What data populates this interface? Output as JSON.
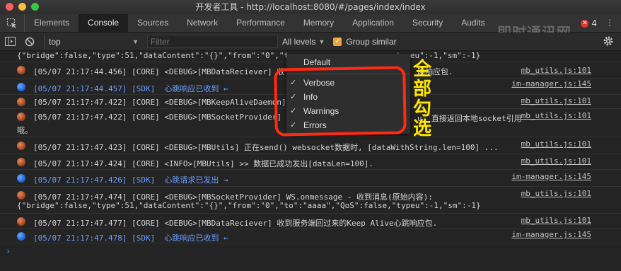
{
  "window": {
    "title": "开发者工具 - http://localhost:8080/#/pages/index/index"
  },
  "tabs": [
    "Elements",
    "Console",
    "Sources",
    "Network",
    "Performance",
    "Memory",
    "Application",
    "Security",
    "Audits"
  ],
  "active_tab": "Console",
  "error_count": "4",
  "toolbar": {
    "context": "top",
    "filter_placeholder": "Filter",
    "levels_label": "All levels",
    "group_similar_label": "Group similar"
  },
  "levels_menu": {
    "items": [
      {
        "label": "Default",
        "checked": false
      },
      {
        "label": "Verbose",
        "checked": true
      },
      {
        "label": "Info",
        "checked": true
      },
      {
        "label": "Warnings",
        "checked": true
      },
      {
        "label": "Errors",
        "checked": true
      }
    ]
  },
  "annotation": {
    "line1": "全",
    "line2": "部",
    "line3": "勾",
    "line4": "选"
  },
  "watermark": "即时通讯网",
  "console": {
    "rows": [
      {
        "kind": "cont",
        "text": "{\"bridge\":false,\"type\":51,\"dataContent\":\"{}\",\"from\":\"0\",\"t",
        "tail": "typeu\":-1,\"sm\":-1}",
        "source": ""
      },
      {
        "kind": "core",
        "text": "[05/07 21:17:44.456] [CORE] <DEBUG>[MBDataReciever] 收",
        "tail": "跳响应包.",
        "source": "mb_utils.js:101"
      },
      {
        "kind": "sdk",
        "text": "[05/07 21:17:44.457] [SDK]  心跳响应已收到 ←",
        "tail": "",
        "source": "im-manager.js:145"
      },
      {
        "kind": "core",
        "text": "[05/07 21:17:47.422] [CORE] <DEBUG>[MBKeepAliveDaemon]",
        "tail": "",
        "source": "mb_utils.js:101"
      },
      {
        "kind": "core",
        "text": "[05/07 21:17:47.422] [CORE] <DEBUG>[MBSocketProvider]",
        "tail": "u, 直接返回本地socket引用",
        "source": "mb_utils.js:101"
      },
      {
        "kind": "cont",
        "text": "哦。",
        "tail": "",
        "source": ""
      },
      {
        "kind": "core",
        "text": "[05/07 21:17:47.423] [CORE] <DEBUG>[MBUtils] 正在send() websocket数据时, [dataWithString.len=100] ...",
        "tail": "",
        "source": "mb_utils.js:101"
      },
      {
        "kind": "core",
        "text": "[05/07 21:17:47.424] [CORE] <INFO>[MBUtils] >> 数据已成功发出[dataLen=100].",
        "tail": "",
        "source": "mb_utils.js:101"
      },
      {
        "kind": "sdk",
        "text": "[05/07 21:17:47.426] [SDK]  心跳请求已发出 →",
        "tail": "",
        "source": "im-manager.js:145"
      },
      {
        "kind": "core",
        "text": "[05/07 21:17:47.474] [CORE] <DEBUG>[MBSocketProvider] WS.onmessage - 收到消息(原始内容):",
        "tail": "",
        "source": "mb_utils.js:101"
      },
      {
        "kind": "cont",
        "text": "{\"bridge\":false,\"type\":51,\"dataContent\":\"{}\",\"from\":\"0\",\"to\":\"aaaa\",\"QoS\":false,\"typeu\":-1,\"sm\":-1}",
        "tail": "",
        "source": ""
      },
      {
        "kind": "core",
        "text": "[05/07 21:17:47.477] [CORE] <DEBUG>[MBDataReciever] 收到服务端回过来的Keep Alive心跳响应包.",
        "tail": "",
        "source": "mb_utils.js:101"
      },
      {
        "kind": "sdk",
        "text": "[05/07 21:17:47.478] [SDK]  心跳响应已收到 ←",
        "tail": "",
        "source": "im-manager.js:145"
      }
    ]
  },
  "colors": {
    "sdk_text": "#6c9cff",
    "annotation_ring": "#ff2a14",
    "annotation_text": "#ffe600",
    "checkbox": "#e8a33b"
  }
}
